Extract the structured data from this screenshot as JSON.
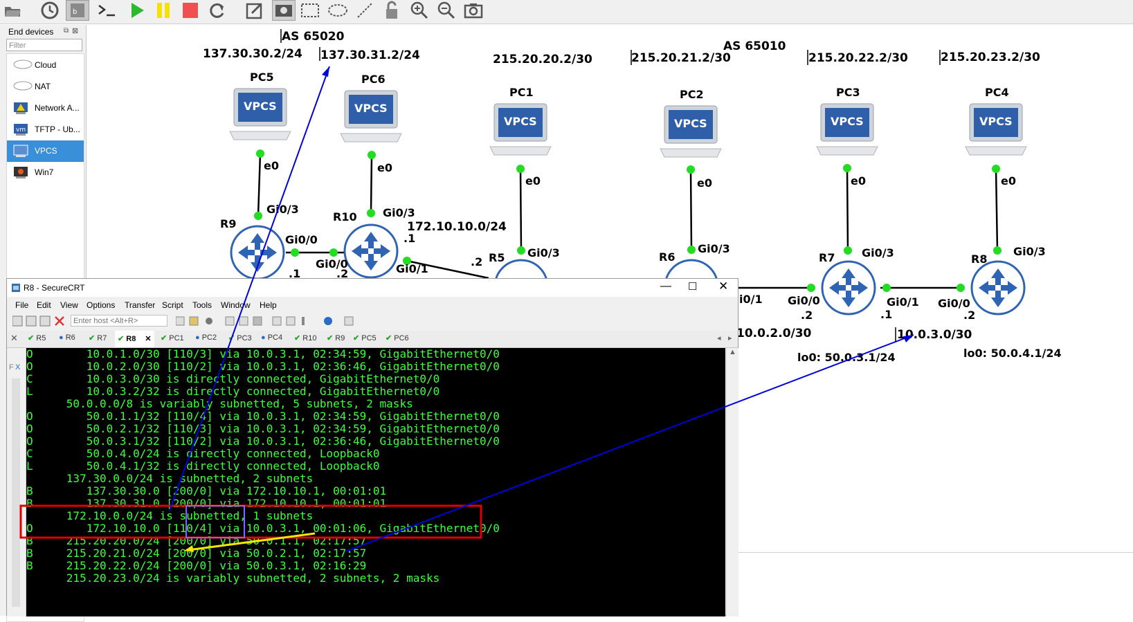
{
  "toolbar": {
    "icons": [
      "folder-open-icon",
      "clock-icon",
      "snapshot-icon",
      "console-icon",
      "start-icon",
      "pause-icon",
      "stop-icon",
      "reload-icon",
      "note-icon",
      "image-icon",
      "rectangle-icon",
      "ellipse-icon",
      "line-icon",
      "lock-icon",
      "zoom-in-icon",
      "zoom-out-icon",
      "screenshot-icon"
    ]
  },
  "dock": {
    "title": "End devices",
    "filter_placeholder": "Filter",
    "items": [
      {
        "label": "Cloud"
      },
      {
        "label": "NAT"
      },
      {
        "label": "Network A..."
      },
      {
        "label": "TFTP - Ub..."
      },
      {
        "label": "VPCS",
        "selected": true
      },
      {
        "label": "Win7"
      }
    ]
  },
  "topology": {
    "as_labels": [
      "AS 65020",
      "AS 65010"
    ],
    "networks": [
      "137.30.30.2/24",
      "137.30.31.2/24",
      "215.20.20.2/30",
      "215.20.21.2/30",
      "215.20.22.2/30",
      "215.20.23.2/30",
      "172.10.10.0/24",
      "10.0.2.0/30",
      "10.0.3.0/30",
      "lo0: 50.0.3.1/24",
      "lo0: 50.0.4.1/24"
    ],
    "pcs": [
      "PC5",
      "PC6",
      "PC1",
      "PC2",
      "PC3",
      "PC4"
    ],
    "vpcs_label": "VPCS",
    "routers": [
      "R9",
      "R10",
      "R5",
      "R6",
      "R7",
      "R8"
    ],
    "interfaces": {
      "e0": "e0",
      "gi03": "Gi0/3",
      "gi00": "Gi0/0",
      "gi01": "Gi0/1",
      "dot1": ".1",
      "dot2": ".2",
      "gi01_partial": "i0/1"
    }
  },
  "securecrt": {
    "title": "R8 - SecureCRT",
    "menu": [
      "File",
      "Edit",
      "View",
      "Options",
      "Transfer",
      "Script",
      "Tools",
      "Window",
      "Help"
    ],
    "host_placeholder": "Enter host <Alt+R>",
    "tabs": [
      "R5",
      "R6",
      "R7",
      "R8",
      "PC1",
      "PC2",
      "PC3",
      "PC4",
      "R10",
      "R9",
      "PC5",
      "PC6"
    ],
    "active_tab": "R8",
    "left_chars": [
      "F",
      "X"
    ],
    "terminal_lines": [
      "O        10.0.1.0/30 [110/3] via 10.0.3.1, 02:34:59, GigabitEthernet0/0",
      "O        10.0.2.0/30 [110/2] via 10.0.3.1, 02:36:46, GigabitEthernet0/0",
      "C        10.0.3.0/30 is directly connected, GigabitEthernet0/0",
      "L        10.0.3.2/32 is directly connected, GigabitEthernet0/0",
      "      50.0.0.0/8 is variably subnetted, 5 subnets, 2 masks",
      "O        50.0.1.1/32 [110/4] via 10.0.3.1, 02:34:59, GigabitEthernet0/0",
      "O        50.0.2.1/32 [110/3] via 10.0.3.1, 02:34:59, GigabitEthernet0/0",
      "O        50.0.3.1/32 [110/2] via 10.0.3.1, 02:36:46, GigabitEthernet0/0",
      "C        50.0.4.0/24 is directly connected, Loopback0",
      "L        50.0.4.1/32 is directly connected, Loopback0",
      "      137.30.0.0/24 is subnetted, 2 subnets",
      "B        137.30.30.0 [200/0] via 172.10.10.1, 00:01:01",
      "B        137.30.31.0 [200/0] via 172.10.10.1, 00:01:01",
      "      172.10.0.0/24 is subnetted, 1 subnets",
      "O        172.10.10.0 [110/4] via 10.0.3.1, 00:01:06, GigabitEthernet0/0",
      "B     215.20.20.0/24 [200/0] via 50.0.1.1, 02:17:57",
      "B     215.20.21.0/24 [200/0] via 50.0.2.1, 02:17:57",
      "B     215.20.22.0/24 [200/0] via 50.0.3.1, 02:16:29",
      "      215.20.23.0/24 is variably subnetted, 2 subnets, 2 masks"
    ]
  },
  "colors": {
    "accent_selected": "#3a8fd9",
    "terminal_text": "#3cff3c",
    "router_blue": "#2f63b3",
    "link_green": "#22dd22",
    "annotation_red": "#e00000",
    "annotation_blue": "#0000dd",
    "annotation_yellow": "#f5e800"
  }
}
